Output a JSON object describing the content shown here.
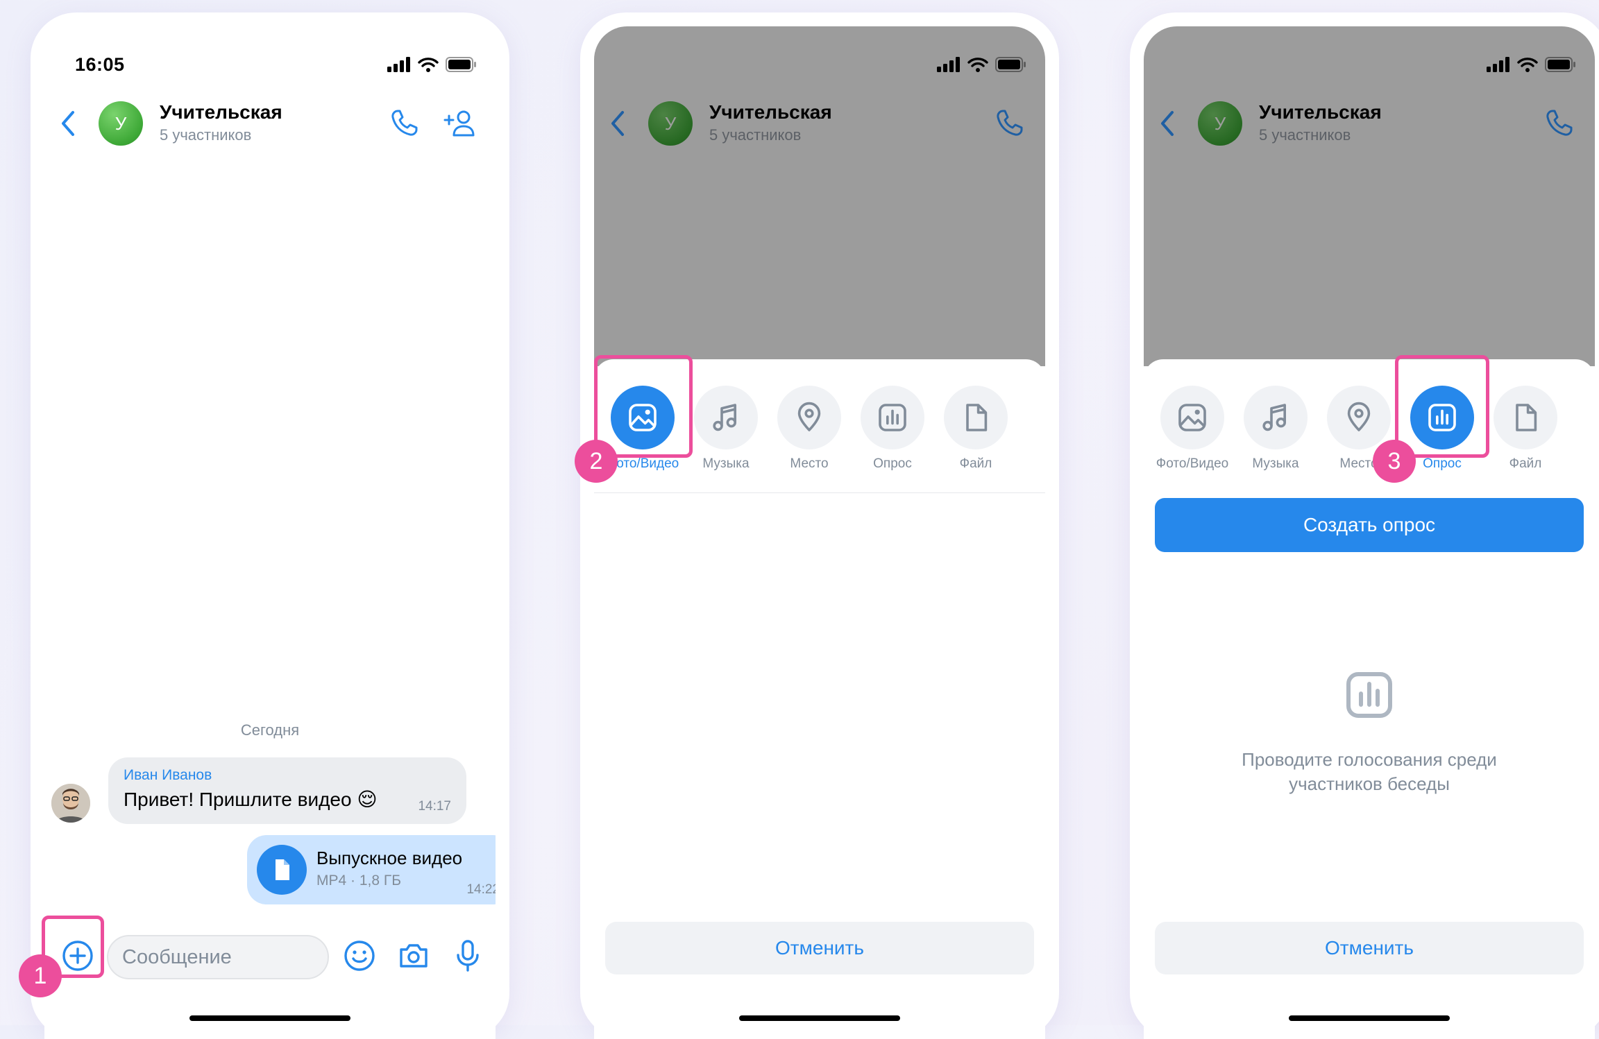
{
  "status": {
    "time": "16:05"
  },
  "chat": {
    "title": "Учительская",
    "subtitle": "5 участников",
    "avatar_letter": "У"
  },
  "phone1": {
    "day_label": "Сегодня",
    "incoming": {
      "sender": "Иван Иванов",
      "text": "Привет! Пришлите видео 😌",
      "time": "14:17"
    },
    "outgoing": {
      "file_title": "Выпускное видео",
      "file_meta": "MP4 · 1,8 ГБ",
      "time": "14:22"
    },
    "composer": {
      "placeholder": "Сообщение"
    },
    "badge": "1"
  },
  "attachments": [
    {
      "label": "Фото/Видео",
      "icon": "photo-icon"
    },
    {
      "label": "Музыка",
      "icon": "music-icon"
    },
    {
      "label": "Место",
      "icon": "place-icon"
    },
    {
      "label": "Опрос",
      "icon": "poll-icon"
    },
    {
      "label": "Файл",
      "icon": "file-icon"
    }
  ],
  "phone2": {
    "active_attachment": "Фото/Видео",
    "cancel": "Отменить",
    "badge": "2"
  },
  "phone3": {
    "active_attachment": "Опрос",
    "create_poll": "Создать опрос",
    "empty_text": "Проводите голосования среди\nучастников беседы",
    "cancel": "Отменить",
    "badge": "3"
  },
  "colors": {
    "accent": "#2688eb",
    "highlight": "#ec4e9c",
    "dim": "#9c9c9c"
  }
}
